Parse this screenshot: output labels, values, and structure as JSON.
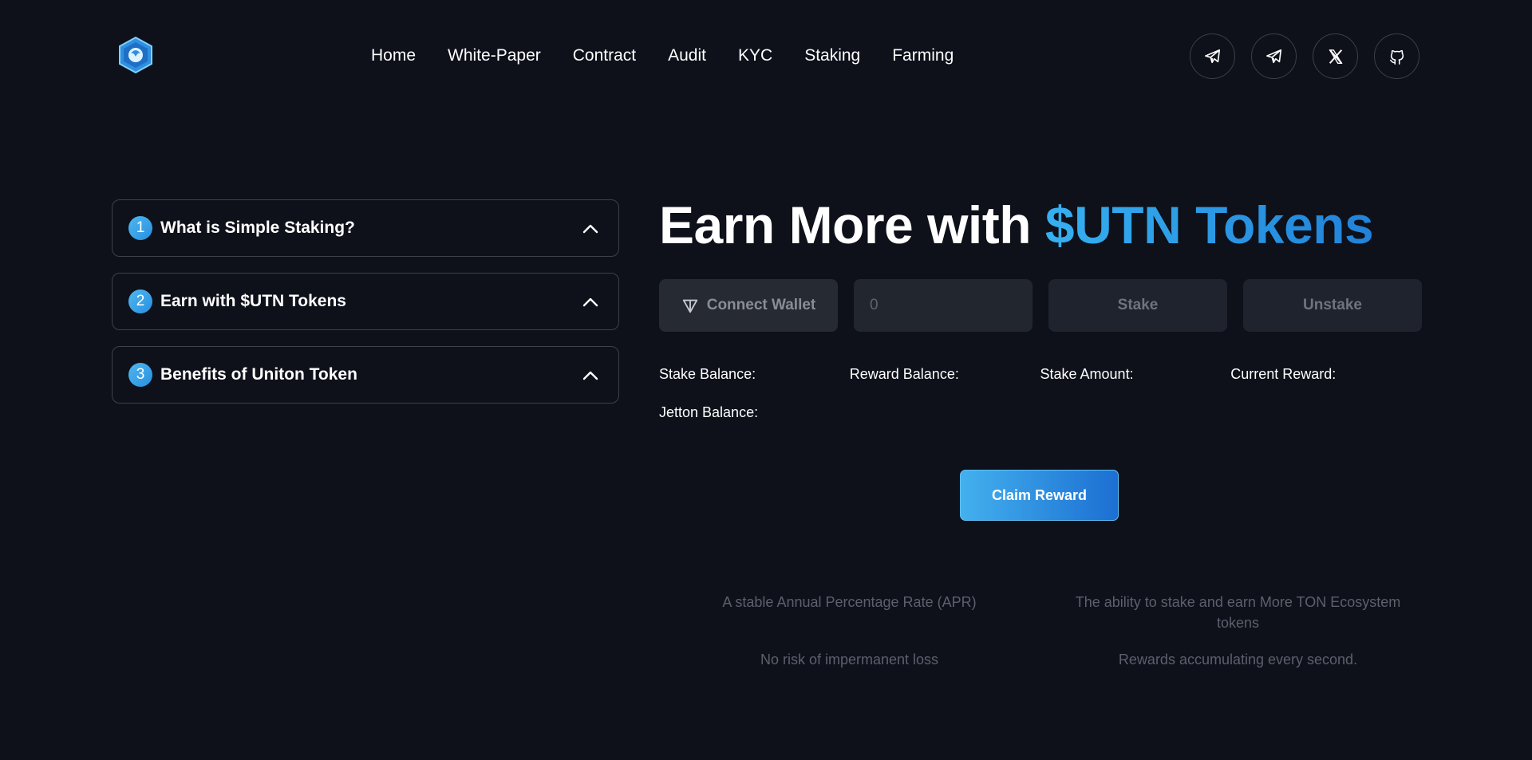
{
  "nav": {
    "items": [
      "Home",
      "White-Paper",
      "Contract",
      "Audit",
      "KYC",
      "Staking",
      "Farming"
    ]
  },
  "socials": [
    "telegram-icon",
    "telegram-icon",
    "x-icon",
    "github-icon"
  ],
  "accordion": {
    "items": [
      {
        "num": "1",
        "title": "What is Simple Staking?"
      },
      {
        "num": "2",
        "title": "Earn with $UTN Tokens"
      },
      {
        "num": "3",
        "title": "Benefits of Uniton Token"
      }
    ]
  },
  "headline": {
    "main": "Earn More with ",
    "accent": "$UTN Tokens"
  },
  "controls": {
    "connect_label": "Connect Wallet",
    "amount_placeholder": "0",
    "stake_label": "Stake",
    "unstake_label": "Unstake"
  },
  "stats": {
    "stake_balance": "Stake Balance:",
    "reward_balance": "Reward Balance:",
    "stake_amount": "Stake Amount:",
    "current_reward": "Current Reward:",
    "jetton_balance": "Jetton Balance:"
  },
  "claim_label": "Claim Reward",
  "features": [
    "A stable Annual Percentage Rate (APR)",
    "The ability to stake and earn More TON Ecosystem tokens",
    "No risk of impermanent loss",
    "Rewards accumulating every second."
  ],
  "colors": {
    "background": "#0e111a",
    "accent": "#2f9fe8",
    "muted_text": "#5c606c"
  }
}
